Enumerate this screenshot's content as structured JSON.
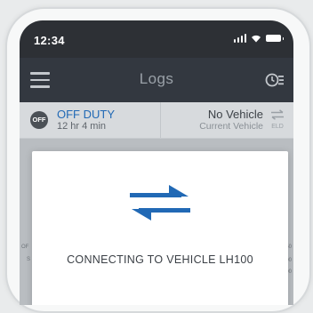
{
  "status_bar": {
    "time": "12:34"
  },
  "app_bar": {
    "title": "Logs"
  },
  "duty": {
    "badge": "OFF",
    "status": "OFF DUTY",
    "duration": "12 hr 4 min",
    "vehicle_name": "No Vehicle",
    "vehicle_sub": "Current Vehicle",
    "eld_label": "ELD"
  },
  "background_rows": {
    "left": [
      "OF",
      "S"
    ],
    "right": [
      "50",
      "00",
      "00"
    ]
  },
  "dialog": {
    "message": "CONNECTING TO  VEHICLE LH100"
  },
  "colors": {
    "accent": "#2169b5",
    "app_bar": "#333840",
    "status_bar": "#2d3035"
  }
}
